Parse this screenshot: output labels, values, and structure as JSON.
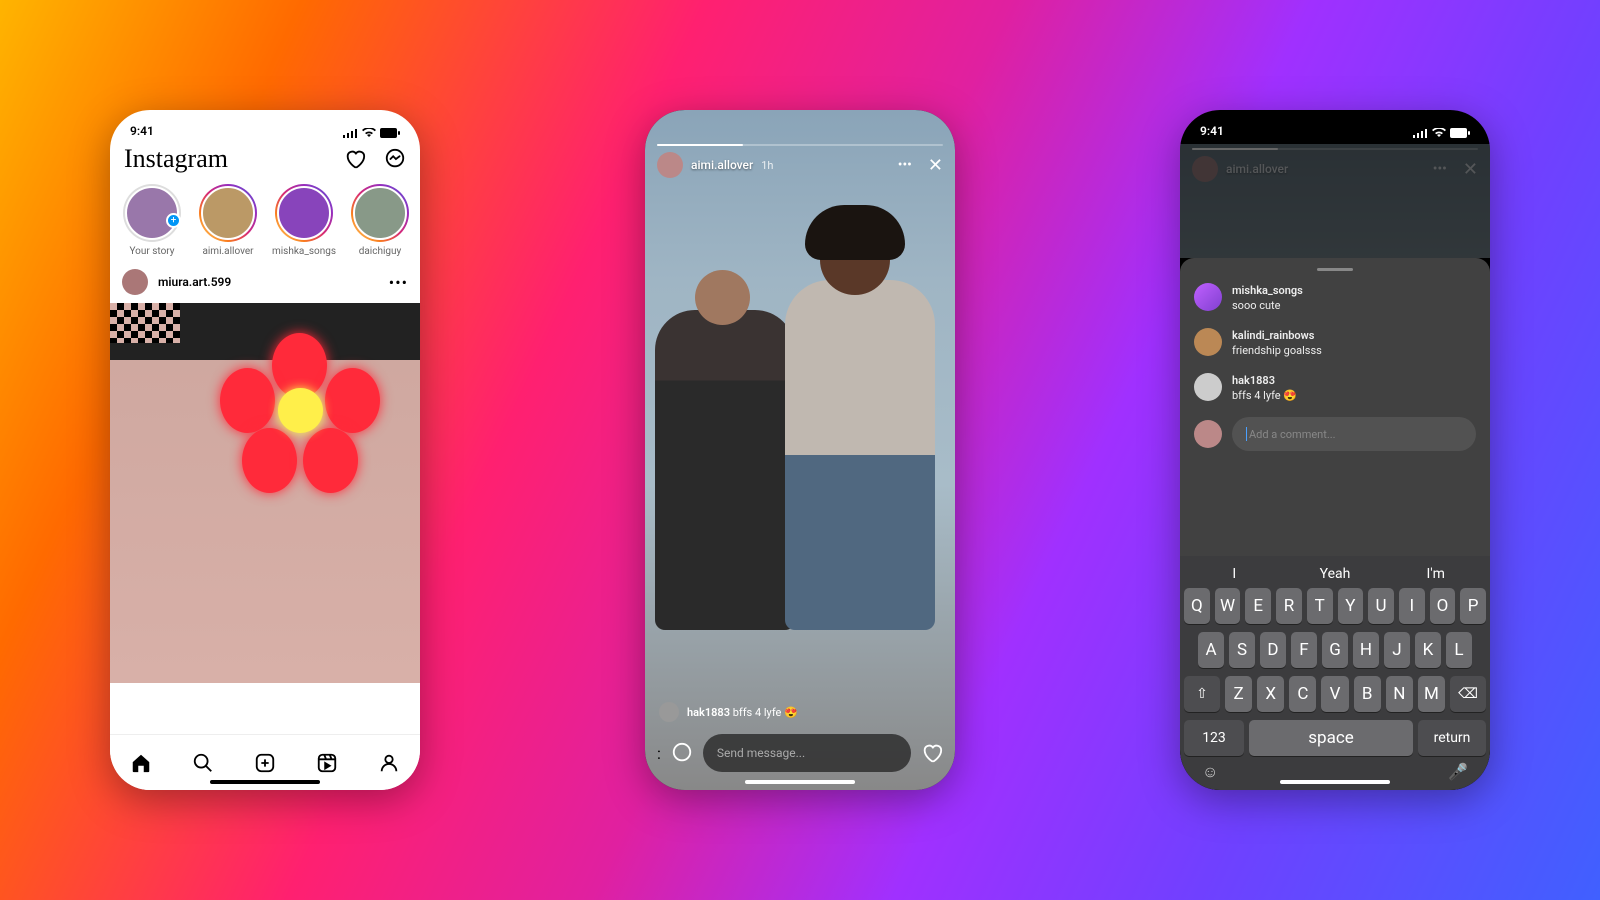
{
  "statusbar": {
    "time": "9:41"
  },
  "phone1": {
    "logo": "Instagram",
    "stories": [
      {
        "label": "Your story",
        "add": true
      },
      {
        "label": "aimi.allover"
      },
      {
        "label": "mishka_songs"
      },
      {
        "label": "daichiguy"
      }
    ],
    "post": {
      "username": "miura.art.599"
    }
  },
  "phone2": {
    "story_user": "aimi.allover",
    "story_time": "1h",
    "comment_user": "hak1883",
    "comment_text": "bffs 4 lyfe 😍",
    "msg_placeholder": "Send message..."
  },
  "phone3": {
    "story_user": "aimi.allover",
    "comments": [
      {
        "user": "mishka_songs",
        "text": "sooo cute"
      },
      {
        "user": "kalindi_rainbows",
        "text": "friendship goalsss"
      },
      {
        "user": "hak1883",
        "text": "bffs 4 lyfe 😍"
      }
    ],
    "input_placeholder": "Add a comment...",
    "suggestions": [
      "I",
      "Yeah",
      "I'm"
    ],
    "keyboard": {
      "row1": [
        "Q",
        "W",
        "E",
        "R",
        "T",
        "Y",
        "U",
        "I",
        "O",
        "P"
      ],
      "row2": [
        "A",
        "S",
        "D",
        "F",
        "G",
        "H",
        "J",
        "K",
        "L"
      ],
      "row3": [
        "Z",
        "X",
        "C",
        "V",
        "B",
        "N",
        "M"
      ],
      "numkey": "123",
      "space": "space",
      "return": "return"
    }
  }
}
